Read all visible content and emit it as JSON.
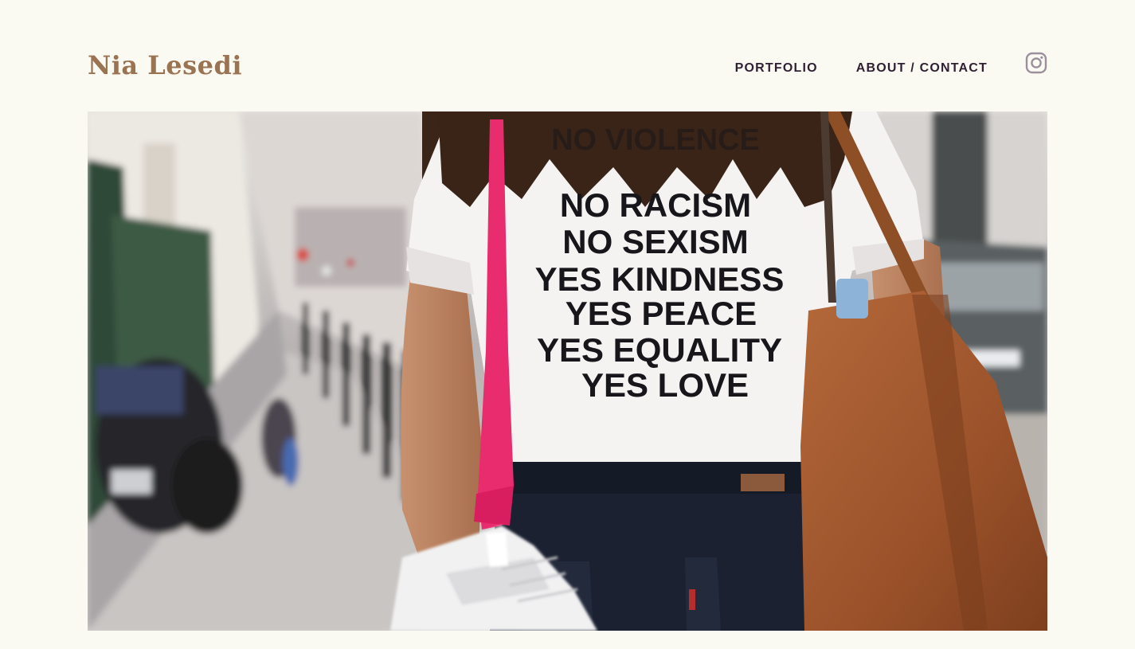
{
  "site": {
    "logo": "Nia Lesedi"
  },
  "nav": {
    "items": [
      {
        "label": "PORTFOLIO"
      },
      {
        "label": "ABOUT / CONTACT"
      }
    ],
    "social_icon": "instagram-icon"
  },
  "hero": {
    "shirt_text": {
      "line1": "NO RACISM",
      "line2": "NO SEXISM",
      "line3": "YES KINDNESS",
      "line4": "YES PEACE",
      "line5": "YES EQUALITY",
      "line6": "YES LOVE"
    }
  },
  "colors": {
    "background": "#fbfaf2",
    "logo": "#9a7352",
    "nav": "#2f1f33",
    "icon": "#9b8f9e"
  }
}
